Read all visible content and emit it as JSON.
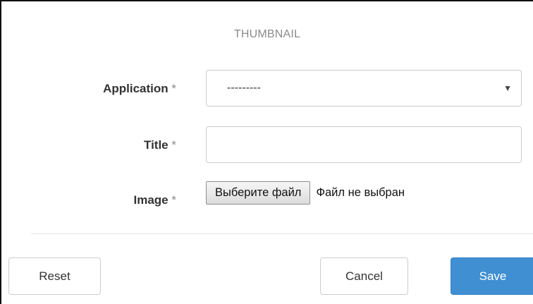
{
  "form": {
    "heading": "THUMBNAIL",
    "required_mark": "*",
    "fields": {
      "application": {
        "label": "Application",
        "selected_value": "---------"
      },
      "title": {
        "label": "Title",
        "value": "",
        "placeholder": ""
      },
      "image": {
        "label": "Image",
        "choose_button_label": "Выберите файл",
        "status_text": "Файл не выбран"
      }
    }
  },
  "actions": {
    "reset_label": "Reset",
    "cancel_label": "Cancel",
    "save_label": "Save"
  },
  "colors": {
    "primary": "#3f8fd2",
    "border": "#cccccc",
    "muted_text": "#8a8a8a",
    "label_text": "#333333"
  },
  "icons": {
    "select_arrow": "caret-down-icon"
  }
}
